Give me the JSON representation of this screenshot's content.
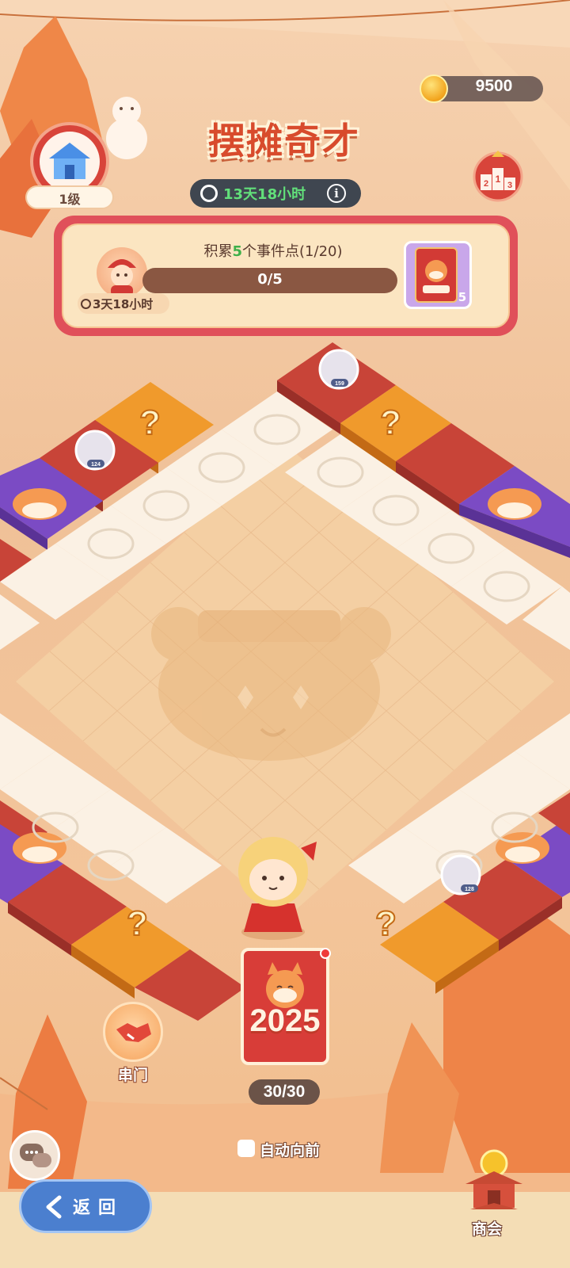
{
  "hud": {
    "coins": "9500",
    "title": "摆摊奇才",
    "season_timer": "13天18小时",
    "info_symbol": "i",
    "level": "1级"
  },
  "rank_badge": {
    "places": [
      "2",
      "1",
      "3"
    ]
  },
  "event": {
    "title_prefix": "积累",
    "title_highlight": "5",
    "title_suffix": "个事件点(1/20)",
    "progress": "0/5",
    "progress_fraction": 0,
    "timer": "3天18小时",
    "reward_count": "5"
  },
  "board": {
    "players": [
      {
        "count": "159"
      },
      {
        "count": "124"
      },
      {
        "count": "128"
      }
    ]
  },
  "deck": {
    "year": "2025",
    "count": "30/30"
  },
  "controls": {
    "visit_label": "串门",
    "auto_label": "自动向前",
    "auto_checked": false,
    "back_label": "返回",
    "guild_label": "商会"
  },
  "colors": {
    "accent_red": "#d84b2c",
    "timer_green": "#62e07a",
    "tile_yellow": "#f09a2c",
    "tile_red": "#c84438",
    "tile_purple": "#7b4bc4",
    "tile_cream": "#fbf1e4",
    "back_button_blue": "#4b7fcf"
  },
  "icons": {
    "coin": "coin-icon",
    "clock": "clock-icon",
    "home": "house-icon",
    "rank": "podium-badge-icon",
    "chat": "chat-bubbles-icon",
    "visit": "handshake-icon",
    "guild": "pagoda-icon",
    "back": "back-arrow-icon"
  }
}
